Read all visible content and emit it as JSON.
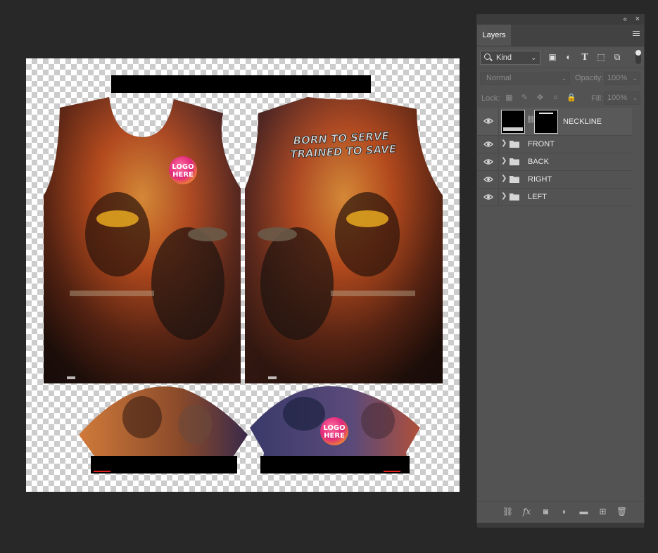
{
  "canvas": {
    "texts": {
      "slogan_line1": "BORN TO SERVE",
      "slogan_line2": "TRAINED TO SAVE",
      "logo_front_1": "LOGO",
      "logo_front_2": "HERE",
      "logo_sleeve_1": "LOGO",
      "logo_sleeve_2": "HERE"
    }
  },
  "panel": {
    "tab_label": "Layers",
    "kind_label": "Kind",
    "blend_mode": "Normal",
    "opacity_label": "Opacity:",
    "opacity_value": "100%",
    "lock_label": "Lock:",
    "fill_label": "Fill:",
    "fill_value": "100%",
    "layers": [
      {
        "name": "NECKLINE",
        "type": "layer",
        "visible": true,
        "selected": true
      },
      {
        "name": "FRONT",
        "type": "group",
        "visible": true
      },
      {
        "name": "BACK",
        "type": "group",
        "visible": true
      },
      {
        "name": "RIGHT",
        "type": "group",
        "visible": true
      },
      {
        "name": "LEFT",
        "type": "group",
        "visible": true
      }
    ]
  },
  "colors": {
    "app_background": "#282828",
    "panel_background": "#535353",
    "fire_orange": "#c8501a",
    "night_blue": "#2c3467",
    "logo_pink": "#e0287a"
  }
}
